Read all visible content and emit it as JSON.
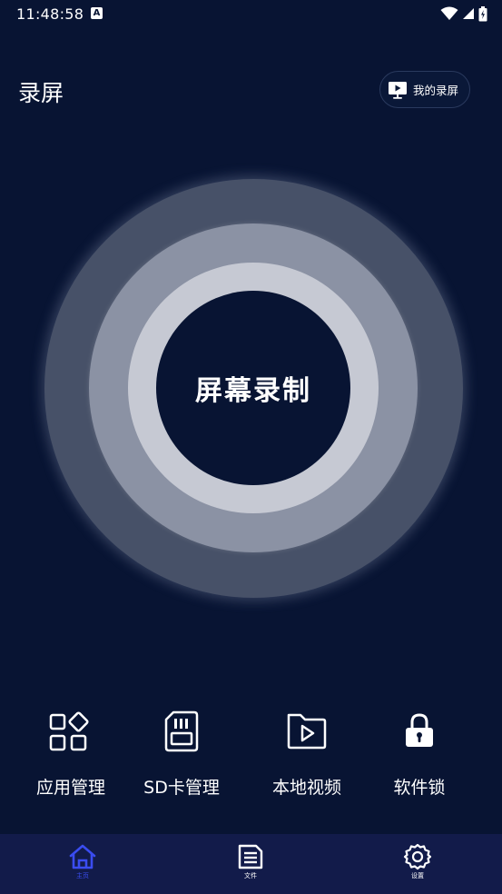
{
  "status_bar": {
    "time": "11:48:58",
    "notification_icon_letter": "A"
  },
  "header": {
    "title": "录屏",
    "my_recordings_label": "我的录屏"
  },
  "record_button": {
    "label": "屏幕录制"
  },
  "features": [
    {
      "label": "应用管理",
      "icon": "grid-apps-icon"
    },
    {
      "label": "SD卡管理",
      "icon": "sd-card-icon"
    },
    {
      "label": "本地视频",
      "icon": "video-folder-icon"
    },
    {
      "label": "软件锁",
      "icon": "lock-icon"
    }
  ],
  "bottom_nav": {
    "items": [
      {
        "label": "主页",
        "icon": "home-icon",
        "active": true
      },
      {
        "label": "文件",
        "icon": "file-list-icon",
        "active": false
      },
      {
        "label": "设置",
        "icon": "gear-icon",
        "active": false
      }
    ]
  },
  "colors": {
    "background": "#081433",
    "nav_background": "#121b4a",
    "active_accent": "#3a4cf0",
    "ring_outer": "#475168",
    "ring_mid": "#8b92a4",
    "ring_inner": "#c6c9d3"
  }
}
